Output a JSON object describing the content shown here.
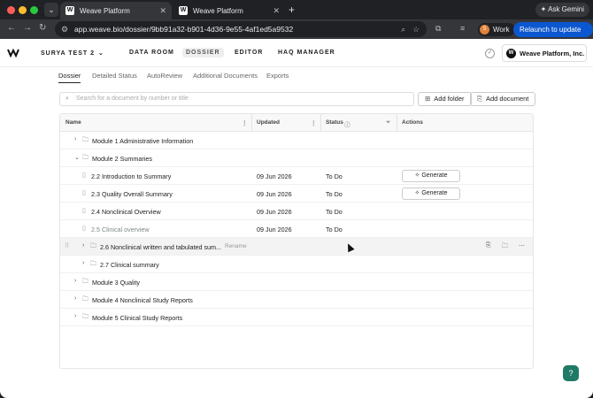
{
  "browser": {
    "tabs": [
      {
        "title": "Weave Platform",
        "active": true
      },
      {
        "title": "Weave Platform",
        "active": false
      }
    ],
    "ask_gemini": "Ask Gemini",
    "url": "app.weave.bio/dossier/9bb91a32-b901-4d36-9e55-4af1ed5a9532",
    "profile": "Work",
    "relaunch": "Relaunch to update"
  },
  "app": {
    "project": "SURYA TEST 2",
    "nav": [
      "DATA ROOM",
      "DOSSIER",
      "EDITOR",
      "HAQ MANAGER"
    ],
    "org": "Weave Platform, Inc."
  },
  "subtabs": [
    "Dossier",
    "Detailed Status",
    "AutoReview",
    "Additional Documents",
    "Exports"
  ],
  "search": {
    "placeholder": "Search for a document by number or title"
  },
  "buttons": {
    "add_folder": "Add folder",
    "add_document": "Add document",
    "generate": "Generate"
  },
  "table": {
    "columns": [
      "Name",
      "Updated",
      "Status",
      "Actions"
    ],
    "rows": [
      {
        "name": "Module 1 Administrative Information",
        "type": "folder",
        "expanded": false,
        "updated": "",
        "status": ""
      },
      {
        "name": "Module 2 Summaries",
        "type": "folder",
        "expanded": true,
        "updated": "",
        "status": ""
      },
      {
        "name": "2.2 Introduction to Summary",
        "type": "doc",
        "updated": "09 Jun 2026",
        "status": "To Do",
        "generate": true
      },
      {
        "name": "2.3 Quality Overall Summary",
        "type": "doc",
        "updated": "09 Jun 2026",
        "status": "To Do",
        "generate": true
      },
      {
        "name": "2.4 Nonclinical Overview",
        "type": "doc",
        "updated": "09 Jun 2026",
        "status": "To Do"
      },
      {
        "name": "2.5 Clinical overview",
        "type": "doc",
        "updated": "09 Jun 2026",
        "status": "To Do"
      },
      {
        "name": "2.6 Nonclinical written and tabulated sum...",
        "type": "folder",
        "rename": "Rename"
      },
      {
        "name": "2.7 Clinical summary",
        "type": "folder"
      },
      {
        "name": "Module 3 Quality",
        "type": "folder"
      },
      {
        "name": "Module 4 Nonclinical Study Reports",
        "type": "folder"
      },
      {
        "name": "Module 5 Clinical Study Reports",
        "type": "folder"
      }
    ]
  },
  "colors": {
    "accent": "#0b57d0",
    "help": "#1f7a66"
  }
}
